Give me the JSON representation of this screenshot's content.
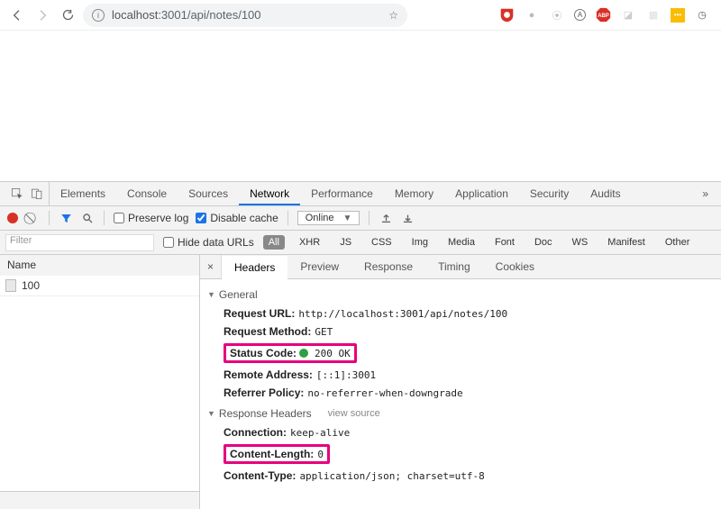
{
  "address": {
    "host": "localhost",
    "port_path": ":3001/api/notes/100"
  },
  "devtools": {
    "tabs": [
      "Elements",
      "Console",
      "Sources",
      "Network",
      "Performance",
      "Memory",
      "Application",
      "Security",
      "Audits"
    ],
    "active_tab": "Network",
    "toolbar": {
      "preserve_log": "Preserve log",
      "disable_cache": "Disable cache",
      "online": "Online"
    },
    "filter": {
      "placeholder": "Filter",
      "hide_data_urls": "Hide data URLs",
      "types": [
        "All",
        "XHR",
        "JS",
        "CSS",
        "Img",
        "Media",
        "Font",
        "Doc",
        "WS",
        "Manifest",
        "Other"
      ]
    },
    "name_col": "Name",
    "request_name": "100",
    "subtabs": [
      "Headers",
      "Preview",
      "Response",
      "Timing",
      "Cookies"
    ],
    "active_subtab": "Headers",
    "sections": {
      "general": {
        "title": "General",
        "items": {
          "request_url_k": "Request URL:",
          "request_url_v": "http://localhost:3001/api/notes/100",
          "request_method_k": "Request Method:",
          "request_method_v": "GET",
          "status_code_k": "Status Code:",
          "status_code_v": "200 OK",
          "remote_addr_k": "Remote Address:",
          "remote_addr_v": "[::1]:3001",
          "referrer_k": "Referrer Policy:",
          "referrer_v": "no-referrer-when-downgrade"
        }
      },
      "response_headers": {
        "title": "Response Headers",
        "view_source": "view source",
        "items": {
          "connection_k": "Connection:",
          "connection_v": "keep-alive",
          "content_length_k": "Content-Length:",
          "content_length_v": "0",
          "content_type_k": "Content-Type:",
          "content_type_v": "application/json; charset=utf-8"
        }
      }
    }
  }
}
